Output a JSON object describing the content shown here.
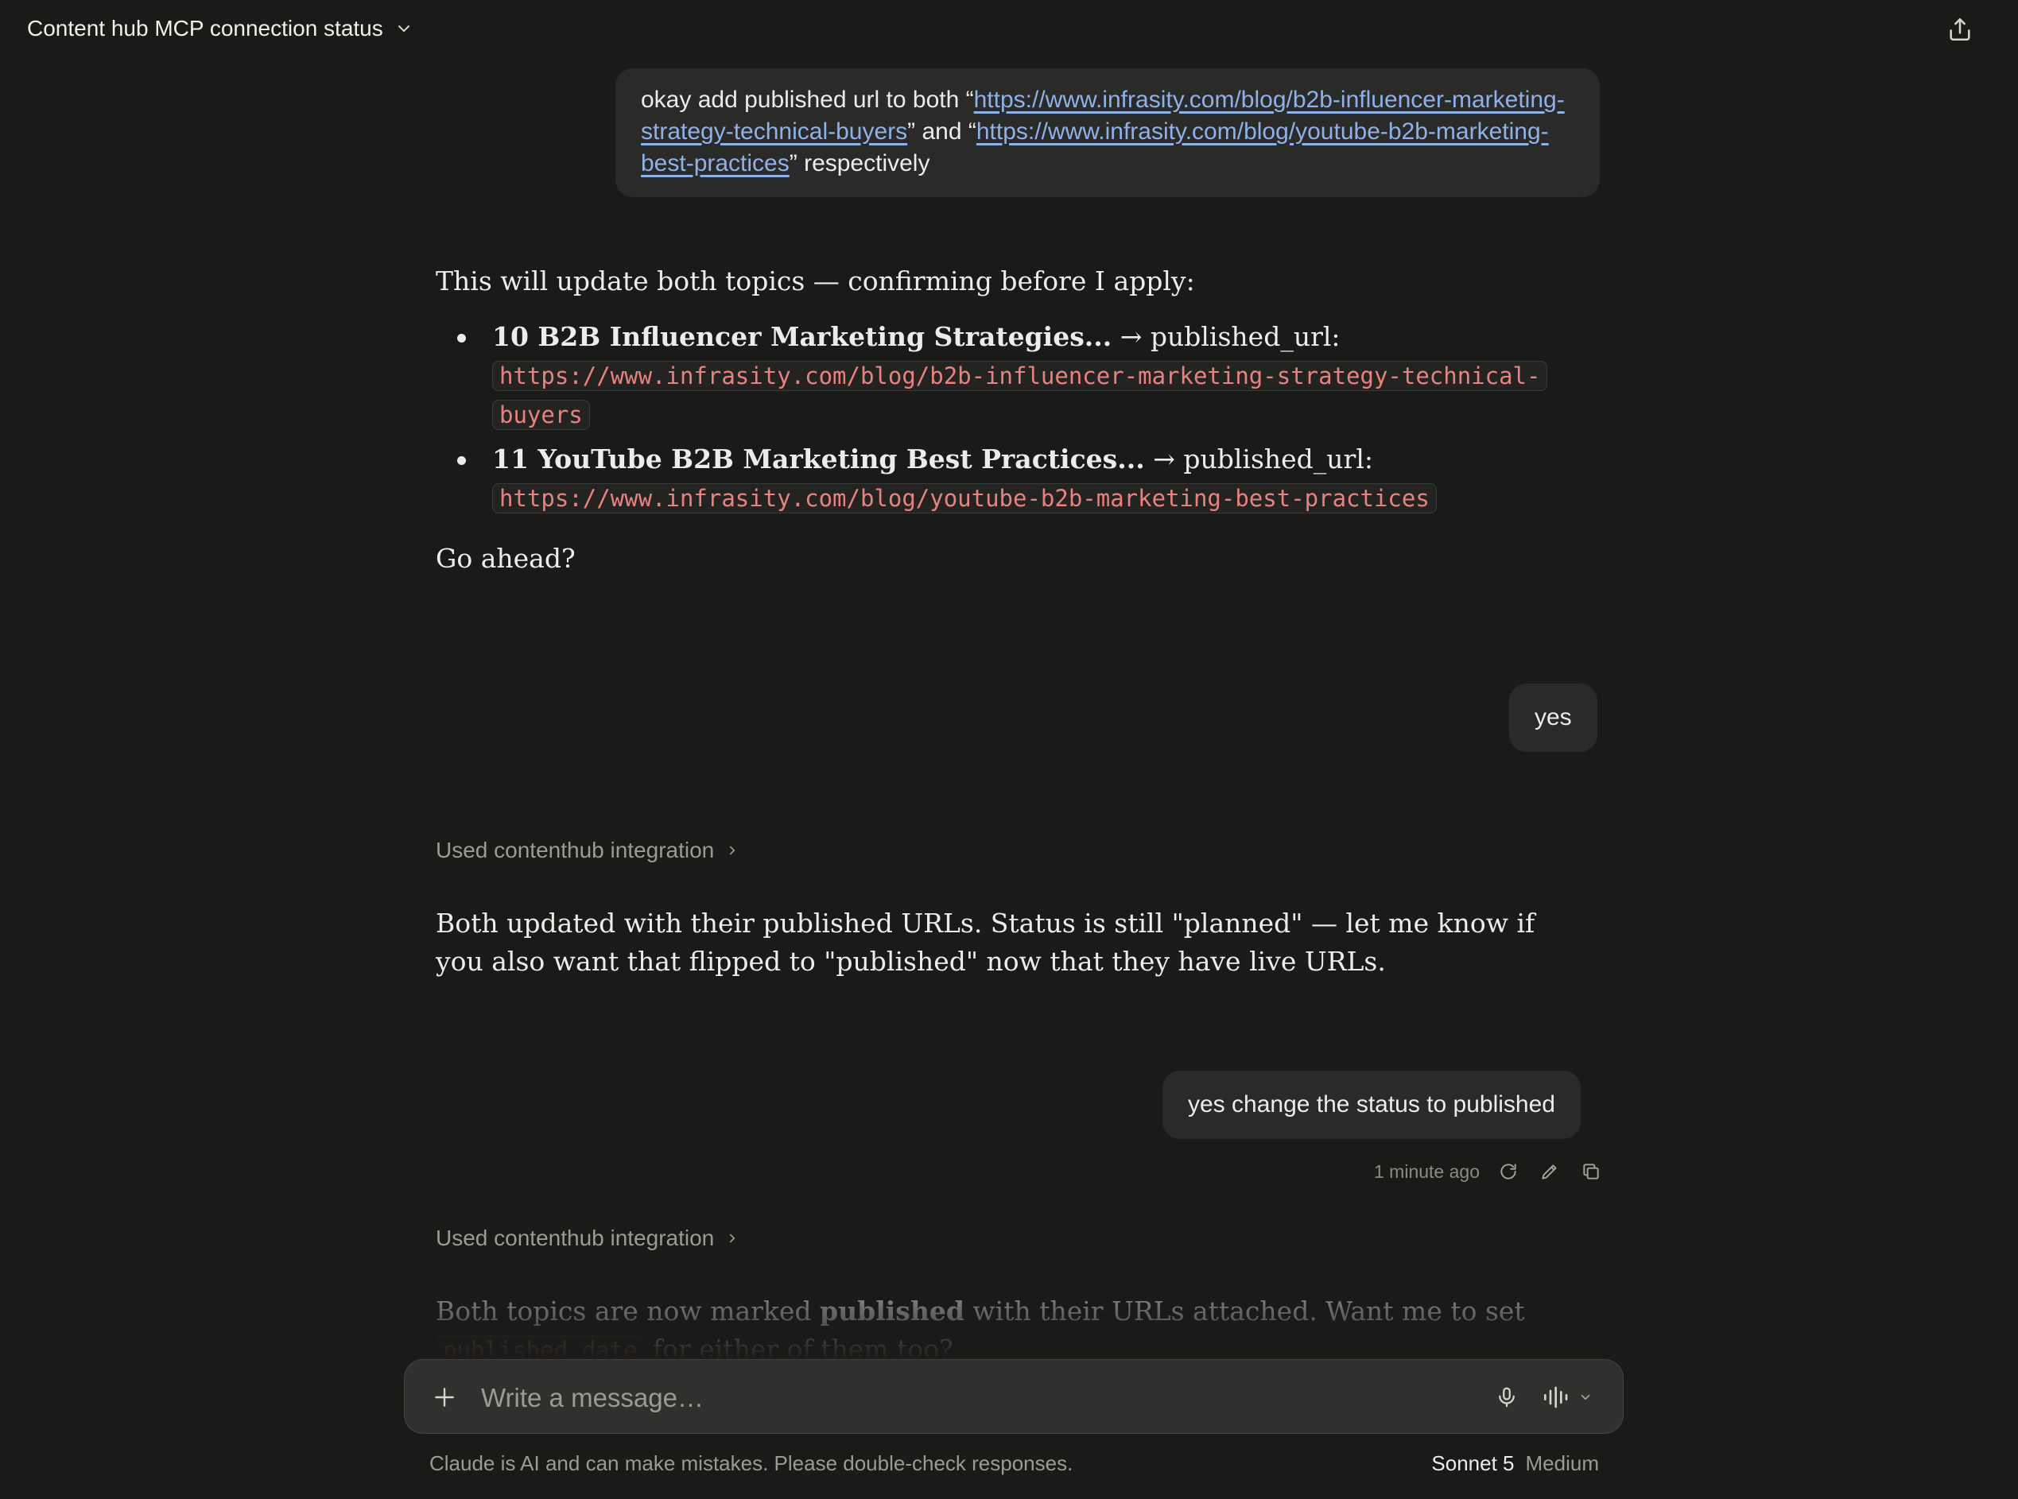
{
  "header": {
    "title": "Content hub MCP connection status"
  },
  "messages": {
    "user_1": {
      "prefix": "okay add published url to both “",
      "link_1": "https://www.infrasity.com/blog/b2b-influencer-marketing-strategy-technical-buyers",
      "middle": "” and “",
      "link_2": "https://www.infrasity.com/blog/youtube-b2b-marketing-best-practices",
      "suffix": "” respectively"
    },
    "assistant_1": {
      "intro": "This will update both topics — confirming before I apply:",
      "items": [
        {
          "title": "10 B2B Influencer Marketing Strategies...",
          "arrow_text": " → published_url: ",
          "url": "https://www.infrasity.com/blog/b2b-influencer-marketing-strategy-technical-buyers"
        },
        {
          "title": "11 YouTube B2B Marketing Best Practices...",
          "arrow_text": " → published_url: ",
          "url": "https://www.infrasity.com/blog/youtube-b2b-marketing-best-practices"
        }
      ],
      "question": "Go ahead?"
    },
    "user_2": "yes",
    "tool_use_1": "Used contenthub integration",
    "assistant_2": "Both updated with their published URLs. Status is still \"planned\" — let me know if you also want that flipped to \"published\" now that they have live URLs.",
    "user_3": "yes change the status to published",
    "user_3_meta": {
      "time": "1 minute ago"
    },
    "tool_use_2": "Used contenthub integration",
    "assistant_3": {
      "part_1": "Both topics are now marked ",
      "bold": "published",
      "part_2": " with their URLs attached. Want me to set ",
      "code": "published_date",
      "part_3": " for either of them too?"
    }
  },
  "composer": {
    "placeholder": "Write a message…"
  },
  "footer": {
    "disclaimer": "Claude is AI and can make mistakes. Please double-check responses.",
    "model_name": "Sonnet 5",
    "model_level": "Medium"
  },
  "colors": {
    "background": "#1a1a19",
    "bubble": "#2a2a28",
    "link": "#8fb1ea",
    "code": "#e8827f"
  }
}
